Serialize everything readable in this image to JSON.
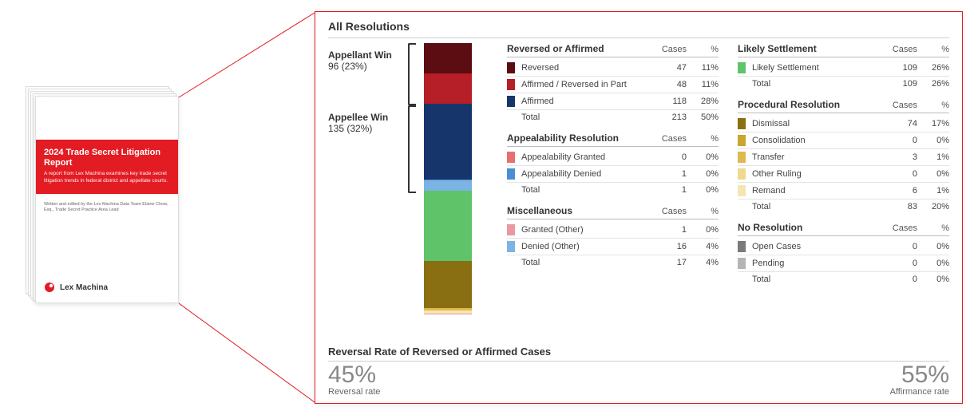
{
  "report": {
    "title": "2024 Trade Secret Litigation Report",
    "subtitle": "A report from Lex Machina examines key trade secret litigation trends in federal district and appellate courts.",
    "credit": "Written and edited by the Lex Machina Data Team\nElaine Chow, Esq., Trade Secret Practice Area Lead",
    "brand": "Lex Machina"
  },
  "panel_title": "All Resolutions",
  "side_labels": {
    "appellant": {
      "name": "Appellant Win",
      "count": "96 (23%)"
    },
    "appellee": {
      "name": "Appellee Win",
      "count": "135 (32%)"
    }
  },
  "headers": {
    "cases": "Cases",
    "pct": "%",
    "total": "Total"
  },
  "colors": {
    "reversed": "#5b0d12",
    "aff_rev_part": "#b61f27",
    "affirmed": "#16356b",
    "appeal_granted": "#e76f6f",
    "appeal_denied": "#4a8fd6",
    "granted_other": "#e99aa0",
    "denied_other": "#7bb4e3",
    "likely_settlement": "#5fc36a",
    "dismissal": "#8a6e12",
    "consolidation": "#caa52f",
    "transfer": "#e0b94e",
    "other_ruling": "#efd98e",
    "remand": "#f3e6b3",
    "open_cases": "#7a7a7a",
    "pending": "#b5b5b5"
  },
  "groups": [
    {
      "name": "Reversed or Affirmed",
      "column": 0,
      "rows": [
        {
          "label": "Reversed",
          "cases": 47,
          "pct": "11%",
          "color_key": "reversed"
        },
        {
          "label": "Affirmed / Reversed in Part",
          "cases": 48,
          "pct": "11%",
          "color_key": "aff_rev_part"
        },
        {
          "label": "Affirmed",
          "cases": 118,
          "pct": "28%",
          "color_key": "affirmed"
        }
      ],
      "total": {
        "cases": 213,
        "pct": "50%"
      }
    },
    {
      "name": "Appealability Resolution",
      "column": 0,
      "rows": [
        {
          "label": "Appealability Granted",
          "cases": 0,
          "pct": "0%",
          "color_key": "appeal_granted"
        },
        {
          "label": "Appealability Denied",
          "cases": 1,
          "pct": "0%",
          "color_key": "appeal_denied"
        }
      ],
      "total": {
        "cases": 1,
        "pct": "0%"
      }
    },
    {
      "name": "Miscellaneous",
      "column": 0,
      "rows": [
        {
          "label": "Granted (Other)",
          "cases": 1,
          "pct": "0%",
          "color_key": "granted_other"
        },
        {
          "label": "Denied (Other)",
          "cases": 16,
          "pct": "4%",
          "color_key": "denied_other"
        }
      ],
      "total": {
        "cases": 17,
        "pct": "4%"
      }
    },
    {
      "name": "Likely Settlement",
      "column": 1,
      "rows": [
        {
          "label": "Likely Settlement",
          "cases": 109,
          "pct": "26%",
          "color_key": "likely_settlement"
        }
      ],
      "total": {
        "cases": 109,
        "pct": "26%"
      }
    },
    {
      "name": "Procedural Resolution",
      "column": 1,
      "rows": [
        {
          "label": "Dismissal",
          "cases": 74,
          "pct": "17%",
          "color_key": "dismissal"
        },
        {
          "label": "Consolidation",
          "cases": 0,
          "pct": "0%",
          "color_key": "consolidation"
        },
        {
          "label": "Transfer",
          "cases": 3,
          "pct": "1%",
          "color_key": "transfer"
        },
        {
          "label": "Other Ruling",
          "cases": 0,
          "pct": "0%",
          "color_key": "other_ruling"
        },
        {
          "label": "Remand",
          "cases": 6,
          "pct": "1%",
          "color_key": "remand"
        }
      ],
      "total": {
        "cases": 83,
        "pct": "20%"
      }
    },
    {
      "name": "No Resolution",
      "column": 1,
      "rows": [
        {
          "label": "Open Cases",
          "cases": 0,
          "pct": "0%",
          "color_key": "open_cases"
        },
        {
          "label": "Pending",
          "cases": 0,
          "pct": "0%",
          "color_key": "pending"
        }
      ],
      "total": {
        "cases": 0,
        "pct": "0%"
      }
    }
  ],
  "stacked_bar": {
    "appellant_keys": [
      "reversed",
      "aff_rev_part"
    ],
    "appellee_keys": [
      "affirmed",
      "denied_other"
    ],
    "segments": [
      {
        "color_key": "reversed",
        "value": 47
      },
      {
        "color_key": "aff_rev_part",
        "value": 48
      },
      {
        "color_key": "affirmed",
        "value": 118
      },
      {
        "color_key": "appeal_denied",
        "value": 1
      },
      {
        "color_key": "denied_other",
        "value": 16
      },
      {
        "color_key": "likely_settlement",
        "value": 109
      },
      {
        "color_key": "dismissal",
        "value": 74
      },
      {
        "color_key": "transfer",
        "value": 3
      },
      {
        "color_key": "remand",
        "value": 6
      },
      {
        "color_key": "granted_other",
        "value": 1
      }
    ],
    "total": 423
  },
  "rates": {
    "title": "Reversal Rate of Reversed or Affirmed Cases",
    "left_big": "45%",
    "left_small": "Reversal rate",
    "right_big": "55%",
    "right_small": "Affirmance rate"
  },
  "chart_data": {
    "type": "bar",
    "title": "All Resolutions",
    "categories": [
      "Reversed",
      "Affirmed / Reversed in Part",
      "Affirmed",
      "Appealability Granted",
      "Appealability Denied",
      "Granted (Other)",
      "Denied (Other)",
      "Likely Settlement",
      "Dismissal",
      "Consolidation",
      "Transfer",
      "Other Ruling",
      "Remand",
      "Open Cases",
      "Pending"
    ],
    "values": [
      47,
      48,
      118,
      0,
      1,
      1,
      16,
      109,
      74,
      0,
      3,
      0,
      6,
      0,
      0
    ],
    "percent": [
      11,
      11,
      28,
      0,
      0,
      0,
      4,
      26,
      17,
      0,
      1,
      0,
      1,
      0,
      0
    ],
    "group_totals": {
      "Reversed or Affirmed": 213,
      "Appealability Resolution": 1,
      "Miscellaneous": 17,
      "Likely Settlement": 109,
      "Procedural Resolution": 83,
      "No Resolution": 0
    },
    "side_totals": {
      "Appellant Win": 96,
      "Appellee Win": 135
    },
    "rates": {
      "Reversal rate": 45,
      "Affirmance rate": 55
    },
    "ylabel": "Cases"
  }
}
